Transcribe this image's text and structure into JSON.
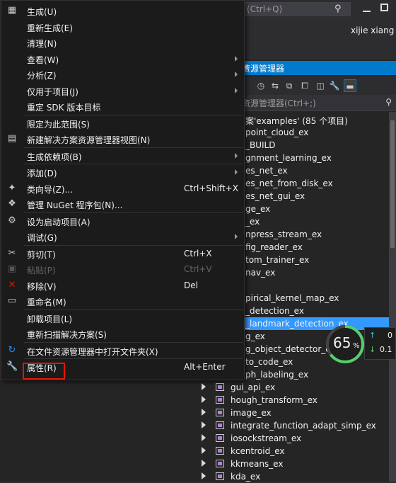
{
  "topbar": {
    "search_placeholder": "(Ctrl+Q)",
    "user_name": "xijie xiang"
  },
  "solution_explorer": {
    "title": "资源管理器",
    "search_placeholder": "资源管理器(Ctrl+;)",
    "rows": [
      {
        "text": "案'examples' (85 个项目)",
        "selected": false,
        "arrow": false,
        "icon": false
      },
      {
        "text": "point_cloud_ex",
        "selected": false,
        "arrow": false,
        "icon": false
      },
      {
        "text": "_BUILD",
        "selected": false,
        "arrow": false,
        "icon": false
      },
      {
        "text": "gnment_learning_ex",
        "selected": false,
        "arrow": false,
        "icon": false
      },
      {
        "text": "es_net_ex",
        "selected": false,
        "arrow": false,
        "icon": false
      },
      {
        "text": "es_net_from_disk_ex",
        "selected": false,
        "arrow": false,
        "icon": false
      },
      {
        "text": "es_net_gui_ex",
        "selected": false,
        "arrow": false,
        "icon": false
      },
      {
        "text": "ge_ex",
        "selected": false,
        "arrow": false,
        "icon": false
      },
      {
        "text": "_ex",
        "selected": false,
        "arrow": false,
        "icon": false
      },
      {
        "text": "npress_stream_ex",
        "selected": false,
        "arrow": false,
        "icon": false
      },
      {
        "text": "fig_reader_ex",
        "selected": false,
        "arrow": false,
        "icon": false
      },
      {
        "text": "tom_trainer_ex",
        "selected": false,
        "arrow": false,
        "icon": false
      },
      {
        "text": "nav_ex",
        "selected": false,
        "arrow": false,
        "icon": false
      },
      {
        "text": "",
        "selected": false,
        "arrow": false,
        "icon": false
      },
      {
        "text": "pirical_kernel_map_ex",
        "selected": false,
        "arrow": false,
        "icon": false
      },
      {
        "text": "_detection_ex",
        "selected": false,
        "arrow": false,
        "icon": false
      },
      {
        "text": "_landmark_detection_ex",
        "selected": true,
        "arrow": false,
        "icon": false
      },
      {
        "text": "g_ex",
        "selected": false,
        "arrow": false,
        "icon": false
      },
      {
        "text": "g_object_detector_ex",
        "selected": false,
        "arrow": false,
        "icon": false
      },
      {
        "text": "to_code_ex",
        "selected": false,
        "arrow": false,
        "icon": false
      },
      {
        "text": "ph_labeling_ex",
        "selected": false,
        "arrow": false,
        "icon": false
      },
      {
        "text": "gui_api_ex",
        "selected": false,
        "arrow": true,
        "icon": true
      },
      {
        "text": "hough_transform_ex",
        "selected": false,
        "arrow": true,
        "icon": true
      },
      {
        "text": "image_ex",
        "selected": false,
        "arrow": true,
        "icon": true
      },
      {
        "text": "integrate_function_adapt_simp_ex",
        "selected": false,
        "arrow": true,
        "icon": true
      },
      {
        "text": "iosockstream_ex",
        "selected": false,
        "arrow": true,
        "icon": true
      },
      {
        "text": "kcentroid_ex",
        "selected": false,
        "arrow": true,
        "icon": true
      },
      {
        "text": "kkmeans_ex",
        "selected": false,
        "arrow": true,
        "icon": true
      },
      {
        "text": "kda_ex",
        "selected": false,
        "arrow": true,
        "icon": true
      }
    ]
  },
  "perf": {
    "percent": "65",
    "percent_sign": "%",
    "up_value": "0",
    "down_value": "0.1",
    "up_arrow": "↑",
    "down_arrow": "↓"
  },
  "menu": {
    "items": [
      {
        "icon": "build-icon",
        "glyph": "▦",
        "label": "生成(U)",
        "shortcut": "",
        "submenu": false,
        "disabled": false
      },
      {
        "icon": "",
        "glyph": "",
        "label": "重新生成(E)",
        "shortcut": "",
        "submenu": false,
        "disabled": false
      },
      {
        "icon": "",
        "glyph": "",
        "label": "清理(N)",
        "shortcut": "",
        "submenu": false,
        "disabled": false
      },
      {
        "icon": "",
        "glyph": "",
        "label": "查看(W)",
        "shortcut": "",
        "submenu": true,
        "disabled": false
      },
      {
        "icon": "",
        "glyph": "",
        "label": "分析(Z)",
        "shortcut": "",
        "submenu": true,
        "disabled": false
      },
      {
        "icon": "",
        "glyph": "",
        "label": "仅用于项目(J)",
        "shortcut": "",
        "submenu": true,
        "disabled": false
      },
      {
        "icon": "",
        "glyph": "",
        "label": "重定 SDK 版本目标",
        "shortcut": "",
        "submenu": false,
        "disabled": false
      },
      {
        "sep": true
      },
      {
        "icon": "",
        "glyph": "",
        "label": "限定为此范围(S)",
        "shortcut": "",
        "submenu": false,
        "disabled": false
      },
      {
        "icon": "new-view-icon",
        "glyph": "▤",
        "label": "新建解决方案资源管理器视图(N)",
        "shortcut": "",
        "submenu": false,
        "disabled": false
      },
      {
        "sep": true
      },
      {
        "icon": "",
        "glyph": "",
        "label": "生成依赖项(B)",
        "shortcut": "",
        "submenu": true,
        "disabled": false
      },
      {
        "sep": true
      },
      {
        "icon": "",
        "glyph": "",
        "label": "添加(D)",
        "shortcut": "",
        "submenu": true,
        "disabled": false
      },
      {
        "icon": "class-wizard-icon",
        "glyph": "✦",
        "label": "类向导(Z)...",
        "shortcut": "Ctrl+Shift+X",
        "submenu": false,
        "disabled": false
      },
      {
        "icon": "nuget-icon",
        "glyph": "❖",
        "label": "管理 NuGet 程序包(N)...",
        "shortcut": "",
        "submenu": false,
        "disabled": false
      },
      {
        "sep": true
      },
      {
        "icon": "gear-icon",
        "glyph": "⚙",
        "label": "设为启动项目(A)",
        "shortcut": "",
        "submenu": false,
        "disabled": false
      },
      {
        "icon": "",
        "glyph": "",
        "label": "调试(G)",
        "shortcut": "",
        "submenu": true,
        "disabled": false
      },
      {
        "sep": true
      },
      {
        "icon": "cut-icon",
        "glyph": "✂",
        "label": "剪切(T)",
        "shortcut": "Ctrl+X",
        "submenu": false,
        "disabled": false
      },
      {
        "icon": "paste-icon",
        "glyph": "▣",
        "label": "粘贴(P)",
        "shortcut": "Ctrl+V",
        "submenu": false,
        "disabled": true
      },
      {
        "icon": "remove-icon",
        "glyph": "✕",
        "label": "移除(V)",
        "shortcut": "Del",
        "submenu": false,
        "disabled": false
      },
      {
        "icon": "rename-icon",
        "glyph": "▭",
        "label": "重命名(M)",
        "shortcut": "",
        "submenu": false,
        "disabled": false
      },
      {
        "sep": true
      },
      {
        "icon": "",
        "glyph": "",
        "label": "卸载项目(L)",
        "shortcut": "",
        "submenu": false,
        "disabled": false
      },
      {
        "icon": "",
        "glyph": "",
        "label": "重新扫描解决方案(S)",
        "shortcut": "",
        "submenu": false,
        "disabled": false
      },
      {
        "sep": true
      },
      {
        "icon": "open-folder-icon",
        "glyph": "↻",
        "label": "在文件资源管理器中打开文件夹(X)",
        "shortcut": "",
        "submenu": false,
        "disabled": false
      },
      {
        "sep": true
      },
      {
        "icon": "wrench-icon",
        "glyph": "🔧",
        "label": "属性(R)",
        "shortcut": "Alt+Enter",
        "submenu": false,
        "disabled": false
      }
    ]
  },
  "colors": {
    "accent": "#007acc",
    "selection": "#3399ff",
    "highlight_box": "#e51400",
    "remove_icon": "#e51400",
    "open_folder_icon": "#1e90ff"
  }
}
